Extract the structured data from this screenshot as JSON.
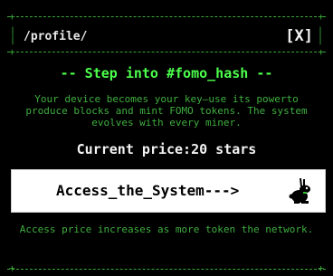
{
  "window": {
    "path": "/profile/",
    "close_label": "[X]"
  },
  "main": {
    "heading": "-- Step into #fomo_hash --",
    "description": "Your device becomes your key—use its powerto produce blocks and mint FOMO tokens. The system evolves with every miner.",
    "price": "Current price:20 stars",
    "access_button_label": "Access_the_System--->",
    "note": "Access price increases as more token the network."
  },
  "icons": {
    "rabbit": "rabbit-icon"
  },
  "colors": {
    "background": "#000000",
    "accent_green": "#4cff4c",
    "text_green": "#3fae3f",
    "button_bg": "#ffffff"
  }
}
